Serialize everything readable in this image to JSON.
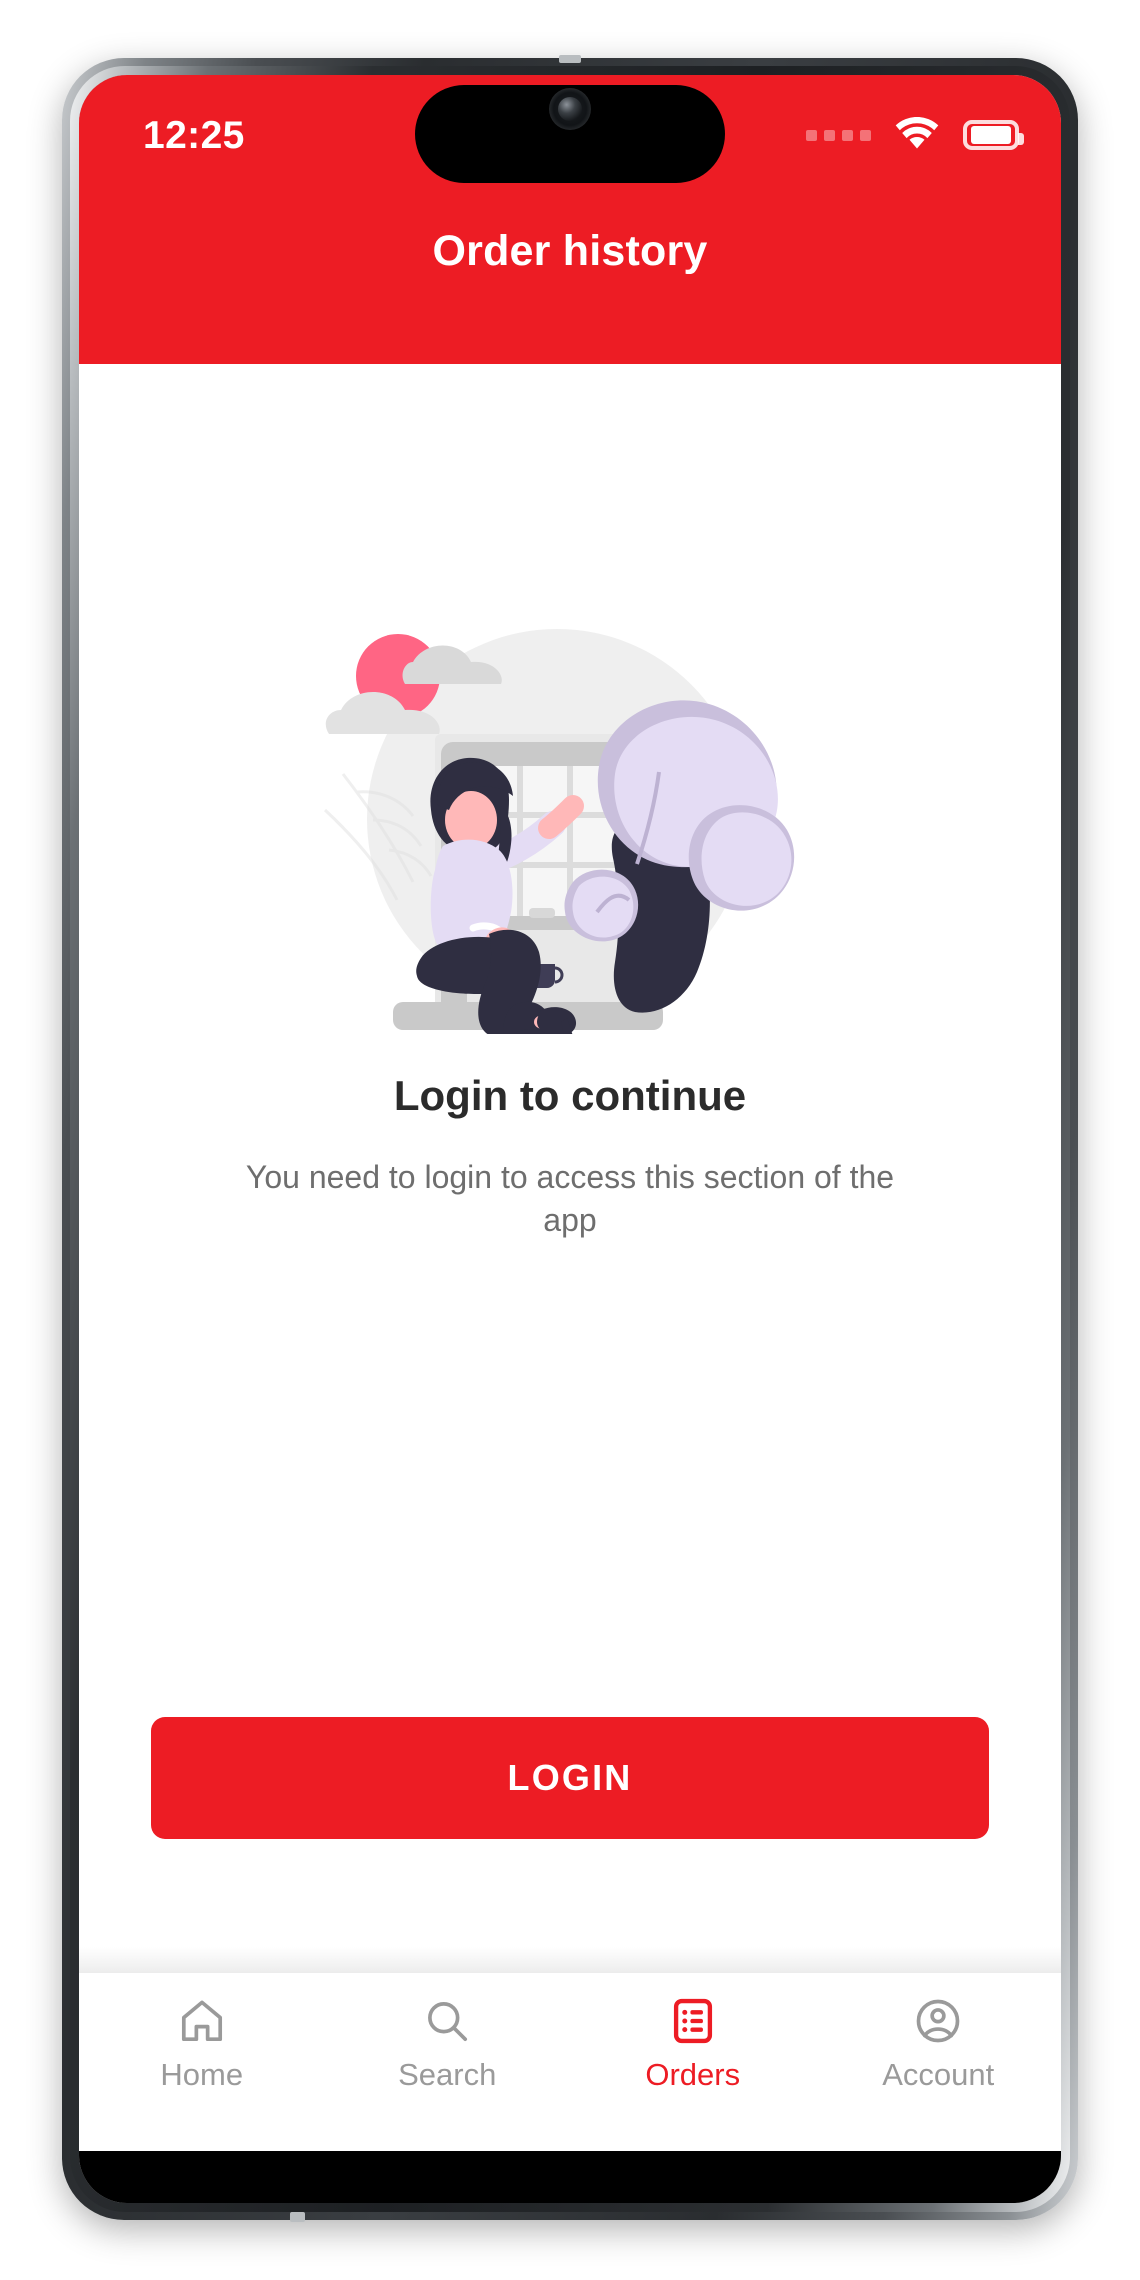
{
  "status_bar": {
    "time": "12:25",
    "signal_icon": "signal-dots-icon",
    "wifi_icon": "wifi-icon",
    "battery_icon": "battery-full-icon"
  },
  "app_bar": {
    "title": "Order history",
    "background_color": "#ED1C24"
  },
  "empty_state": {
    "illustration_name": "woman-sitting-at-window-with-plant-illustration",
    "title": "Login to continue",
    "message": "You need to login to access this section of the app"
  },
  "primary_action": {
    "label": "LOGIN",
    "background_color": "#ED1C24",
    "text_color": "#FFFFFF"
  },
  "bottom_nav": {
    "active_color": "#ED1C24",
    "inactive_color": "#9A9A9A",
    "items": [
      {
        "label": "Home",
        "icon": "home-icon",
        "active": false
      },
      {
        "label": "Search",
        "icon": "search-icon",
        "active": false
      },
      {
        "label": "Orders",
        "icon": "orders-list-icon",
        "active": true
      },
      {
        "label": "Account",
        "icon": "account-person-icon",
        "active": false
      }
    ]
  },
  "illustration_colors": {
    "backdrop_circle": "#EFEFEF",
    "sun": "#FF6584",
    "cloud": "#D4D4D4",
    "window_frame": "#C4C4C4",
    "plant_leaf": "#E4DCF4",
    "plant_leaf_dark": "#C9BFDC",
    "plant_pot": "#2F2E41",
    "hair": "#2F2E41",
    "skin": "#FFB8B8",
    "shirt": "#E4DCF4",
    "pants": "#2F2E41"
  }
}
